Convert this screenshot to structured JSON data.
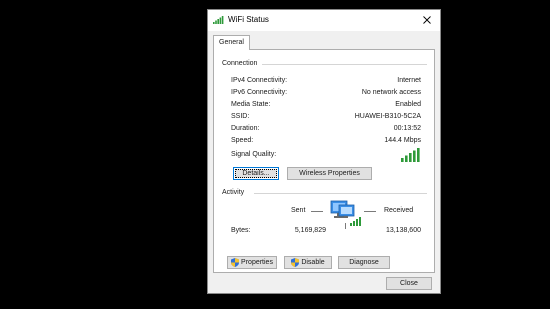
{
  "window": {
    "title": "WiFi Status",
    "close_icon": "close-icon",
    "title_icon": "wifi-signal-icon"
  },
  "tabs": [
    "General"
  ],
  "connection": {
    "heading": "Connection",
    "rows": [
      {
        "label": "IPv4 Connectivity:",
        "value": "Internet"
      },
      {
        "label": "IPv6 Connectivity:",
        "value": "No network access"
      },
      {
        "label": "Media State:",
        "value": "Enabled"
      },
      {
        "label": "SSID:",
        "value": "HUAWEI-B310-5C2A"
      },
      {
        "label": "Duration:",
        "value": "00:13:52"
      },
      {
        "label": "Speed:",
        "value": "144.4 Mbps"
      }
    ],
    "signal_label": "Signal Quality:",
    "signal_bars": 5,
    "details_button": "Details...",
    "wireless_button": "Wireless Properties"
  },
  "activity": {
    "heading": "Activity",
    "sent_label": "Sent",
    "received_label": "Received",
    "bytes_label": "Bytes:",
    "bytes_sent": "5,169,829",
    "bytes_received": "13,138,600"
  },
  "actions": {
    "properties": "Properties",
    "disable": "Disable",
    "diagnose": "Diagnose"
  },
  "footer": {
    "close": "Close"
  },
  "colors": {
    "signal_green": "#2e9a3a",
    "accent": "#0078d7"
  }
}
